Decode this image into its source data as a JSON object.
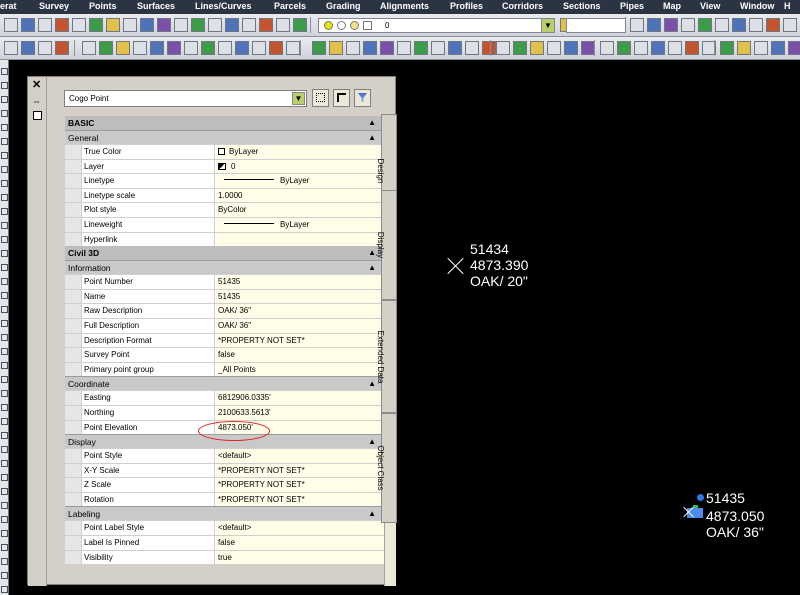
{
  "menubar": {
    "items": [
      "erat",
      "Survey",
      "Points",
      "Surfaces",
      "Lines/Curves",
      "Parcels",
      "Grading",
      "Alignments",
      "Profiles",
      "Corridors",
      "Sections",
      "Pipes",
      "Map",
      "View",
      "Window",
      "H"
    ]
  },
  "toolbar": {
    "layer_value": "0",
    "layer_colors": [
      "#e6e600",
      "#ffffff",
      "#f5e08a",
      "#ffffff"
    ]
  },
  "palette": {
    "object_type": "Cogo Point",
    "tabs": [
      "Design",
      "Display",
      "Extended Data",
      "Object Class"
    ],
    "sections": [
      {
        "title": "BASIC",
        "groups": [
          {
            "title": "General",
            "rows": [
              {
                "label": "True Color",
                "value": "ByLayer"
              },
              {
                "label": "Layer",
                "value": "0"
              },
              {
                "label": "Linetype",
                "value": "ByLayer"
              },
              {
                "label": "Linetype scale",
                "value": "1.0000"
              },
              {
                "label": "Plot style",
                "value": "ByColor"
              },
              {
                "label": "Lineweight",
                "value": "ByLayer"
              },
              {
                "label": "Hyperlink",
                "value": ""
              }
            ]
          }
        ]
      },
      {
        "title": "Civil 3D",
        "groups": [
          {
            "title": "Information",
            "rows": [
              {
                "label": "Point Number",
                "value": "51435"
              },
              {
                "label": "Name",
                "value": "51435"
              },
              {
                "label": "Raw Description",
                "value": "OAK/ 36\""
              },
              {
                "label": "Full Description",
                "value": "OAK/ 36\""
              },
              {
                "label": "Description Format",
                "value": "*PROPERTY NOT SET*"
              },
              {
                "label": "Survey Point",
                "value": "false"
              },
              {
                "label": "Primary point group",
                "value": "_All Points"
              }
            ]
          },
          {
            "title": "Coordinate",
            "rows": [
              {
                "label": "Easting",
                "value": "6812906.0335'"
              },
              {
                "label": "Northing",
                "value": "2100633.5613'"
              },
              {
                "label": "Point Elevation",
                "value": "4873.050'"
              }
            ]
          },
          {
            "title": "Display",
            "rows": [
              {
                "label": "Point Style",
                "value": "<default>"
              },
              {
                "label": "X-Y Scale",
                "value": "*PROPERTY NOT SET*"
              },
              {
                "label": "Z Scale",
                "value": "*PROPERTY NOT SET*"
              },
              {
                "label": "Rotation",
                "value": "*PROPERTY NOT SET*"
              }
            ]
          },
          {
            "title": "Labeling",
            "rows": [
              {
                "label": "Point Label Style",
                "value": "<default>"
              },
              {
                "label": "Label Is Pinned",
                "value": "false"
              },
              {
                "label": "Visibility",
                "value": "true"
              }
            ]
          }
        ]
      }
    ]
  },
  "drawing": {
    "point1": {
      "number": "51434",
      "elevation": "4873.390",
      "description": "OAK/ 20\""
    },
    "point2": {
      "number": "51435",
      "elevation": "4873.050",
      "description": "OAK/ 36\""
    }
  }
}
